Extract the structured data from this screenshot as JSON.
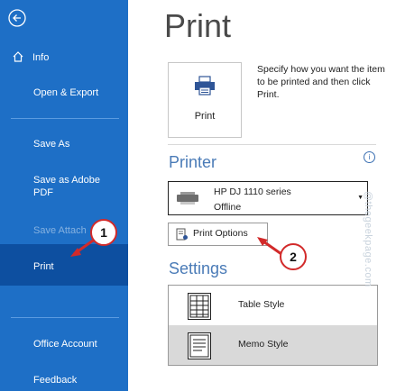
{
  "sidebar": {
    "back_icon": "back-arrow-icon",
    "items": [
      {
        "label": "Info",
        "icon": "home-icon"
      },
      {
        "label": "Open & Export"
      },
      {
        "label": "Save As"
      },
      {
        "label": "Save as Adobe PDF"
      },
      {
        "label": "Save Attach"
      },
      {
        "label": "Print"
      },
      {
        "label": "Office Account"
      },
      {
        "label": "Feedback"
      }
    ],
    "selected": "Print"
  },
  "main": {
    "title": "Print",
    "print_button_label": "Print",
    "description": "Specify how you want the item to be printed and then click Print.",
    "printer_heading": "Printer",
    "printer": {
      "name": "HP DJ 1110 series",
      "status": "Offline"
    },
    "print_options_label": "Print Options",
    "settings_heading": "Settings",
    "styles": [
      {
        "label": "Table Style",
        "selected": false
      },
      {
        "label": "Memo Style",
        "selected": true
      }
    ]
  },
  "annotations": {
    "badge1": "1",
    "badge2": "2"
  },
  "watermark": "@thegeekpage.com",
  "colors": {
    "sidebar_bg": "#1e6fc6",
    "sidebar_selected": "#0d4fa0",
    "heading_blue": "#4a7bb7",
    "selected_style_bg": "#d9d9d9",
    "annotation_red": "#d22a2a"
  }
}
